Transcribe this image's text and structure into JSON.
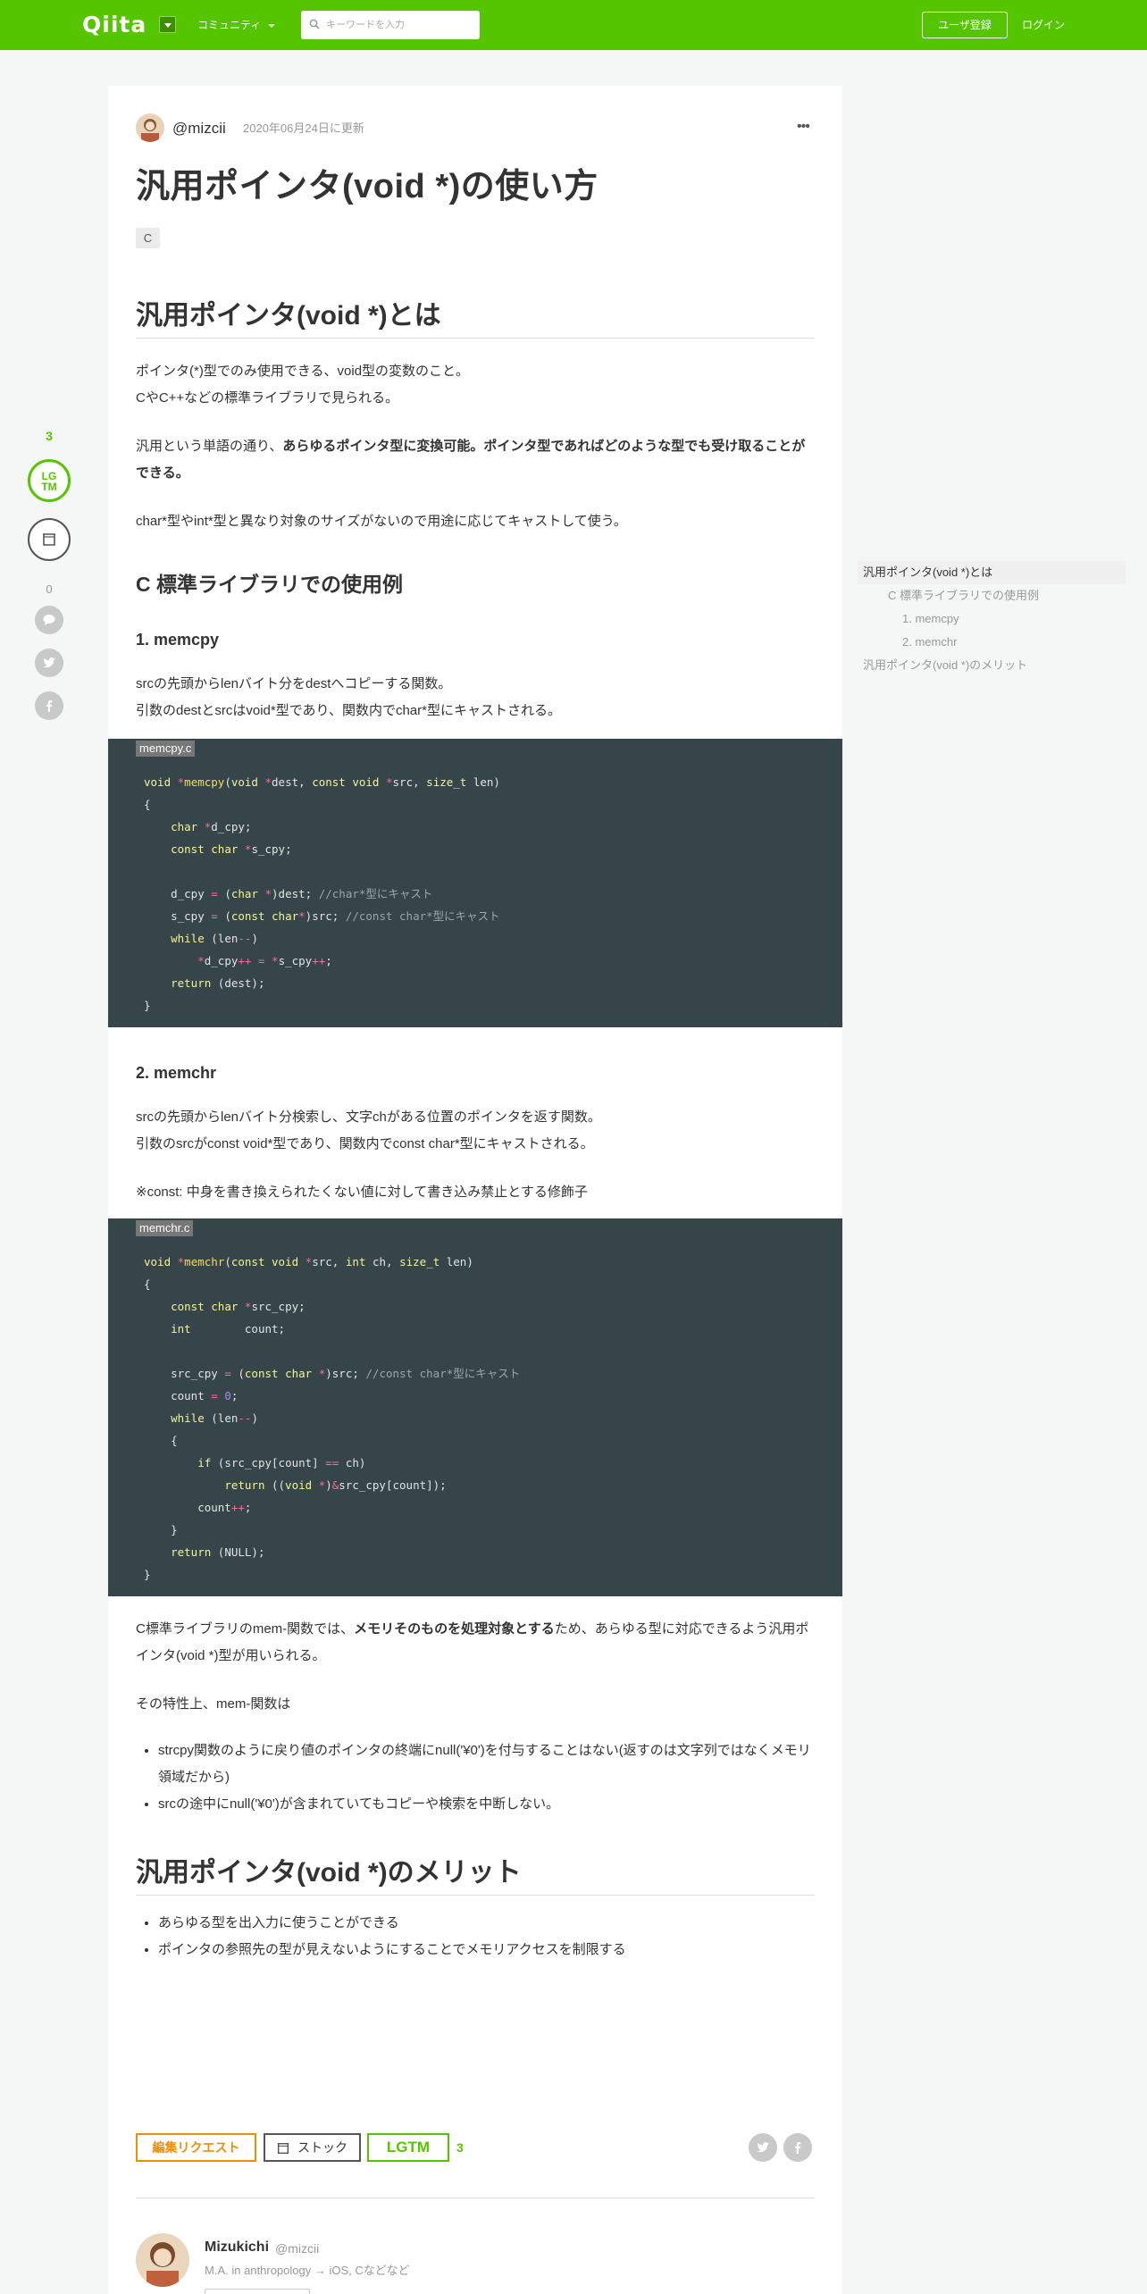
{
  "header": {
    "logo": "Qiita",
    "community": "コミュニティ",
    "search_placeholder": "キーワードを入力",
    "signup": "ユーザ登録",
    "login": "ログイン"
  },
  "rail": {
    "lgtm_count": "3",
    "lgtm_label_top": "LG",
    "lgtm_label_bottom": "TM",
    "comment_count": "0"
  },
  "article": {
    "author": "@mizcii",
    "updated": "2020年06月24日に更新",
    "title": "汎用ポインタ(void *)の使い方",
    "tag": "C",
    "h1_what": "汎用ポインタ(void *)とは",
    "p1_line1": "ポインタ(*)型でのみ使用できる、void型の変数のこと。",
    "p1_line2": "CやC++などの標準ライブラリで見られる。",
    "p2_prefix": "汎用という単語の通り、",
    "p2_bold": "あらゆるポインタ型に変換可能。ポインタ型であればどのような型でも受け取ることができる。",
    "p3": "char*型やint*型と異なり対象のサイズがないので用途に応じてキャストして使う。",
    "h2_lib": "C 標準ライブラリでの使用例",
    "h3_memcpy": "1. memcpy",
    "memcpy_line1": "srcの先頭からlenバイト分をdestへコピーする関数。",
    "memcpy_line2": "引数のdestとsrcはvoid*型であり、関数内でchar*型にキャストされる。",
    "memcpy_file": "memcpy.c",
    "h3_memchr": "2. memchr",
    "memchr_line1": "srcの先頭からlenバイト分検索し、文字chがある位置のポインタを返す関数。",
    "memchr_line2": "引数のsrcがconst void*型であり、関数内でconst char*型にキャストされる。",
    "memchr_note": "※const: 中身を書き換えられたくない値に対して書き込み禁止とする修飾子",
    "memchr_file": "memchr.c",
    "summary_prefix": "C標準ライブラリのmem-関数では、",
    "summary_bold": "メモリそのものを処理対象とする",
    "summary_suffix": "ため、あらゆる型に対応できるよう汎用ポインタ(void *)型が用いられる。",
    "trait_intro": "その特性上、mem-関数は",
    "trait_items": [
      "strcpy関数のように戻り値のポインタの終端にnull('¥0')を付与することはない(返すのは文字列ではなくメモリ領域だから)",
      "srcの途中にnull('¥0')が含まれていてもコピーや検索を中断しない。"
    ],
    "h1_merit": "汎用ポインタ(void *)のメリット",
    "merit_items": [
      "あらゆる型を出入力に使うことができる",
      "ポインタの参照先の型が見えないようにすることでメモリアクセスを制限する"
    ]
  },
  "actions": {
    "edit_request": "編集リクエスト",
    "stock": "ストック",
    "lgtm": "LGTM",
    "lgtm_count": "3"
  },
  "profile": {
    "name": "Mizukichi",
    "handle": "@mizcii",
    "description": "M.A. in anthropology → iOS, Cなどなど"
  },
  "toc": [
    {
      "label": "汎用ポインタ(void *)とは",
      "level": 1,
      "active": true
    },
    {
      "label": "C 標準ライブラリでの使用例",
      "level": 2,
      "active": false
    },
    {
      "label": "1. memcpy",
      "level": 3,
      "active": false
    },
    {
      "label": "2. memchr",
      "level": 3,
      "active": false
    },
    {
      "label": "汎用ポインタ(void *)のメリット",
      "level": 1,
      "active": false
    }
  ],
  "colors": {
    "brand": "#55c500",
    "code_bg": "#364549",
    "edit": "#f08d00"
  }
}
